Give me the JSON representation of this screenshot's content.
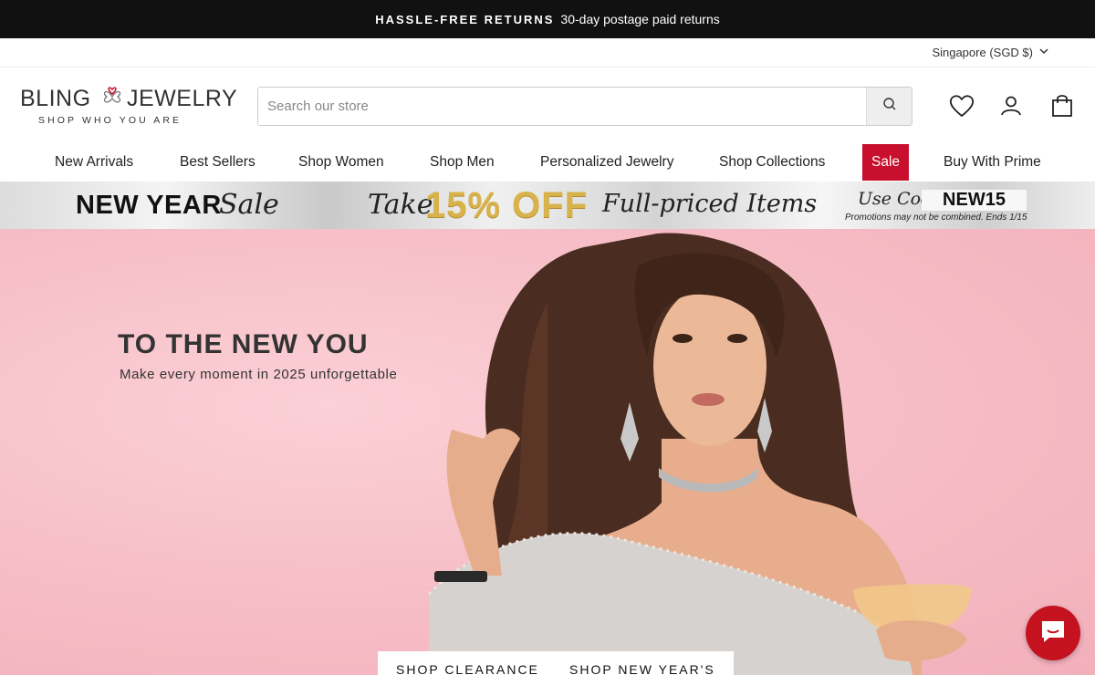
{
  "announcement": {
    "strong": "HASSLE-FREE RETURNS",
    "text": "30-day postage paid returns"
  },
  "locale": {
    "label": "Singapore (SGD $)"
  },
  "logo": {
    "word_left": "BLING",
    "word_right": "JEWELRY",
    "tagline": "SHOP WHO YOU ARE"
  },
  "search": {
    "placeholder": "Search our store"
  },
  "nav": {
    "items": [
      {
        "label": "New Arrivals"
      },
      {
        "label": "Best Sellers"
      },
      {
        "label": "Shop Women"
      },
      {
        "label": "Shop Men"
      },
      {
        "label": "Personalized Jewelry"
      },
      {
        "label": "Shop Collections"
      },
      {
        "label": "Sale"
      },
      {
        "label": "Buy With Prime"
      }
    ]
  },
  "promo": {
    "new_year": "NEW YEAR",
    "sale": "Sale",
    "take": "Take",
    "off": "15% OFF",
    "full_priced": "Full-priced Items",
    "use_code": "Use Code",
    "code": "NEW15",
    "fine_print": "Promotions may not be combined. Ends 1/15"
  },
  "hero": {
    "title": "TO THE NEW YOU",
    "subtitle": "Make every moment in 2025 unforgettable",
    "btn_clearance": "SHOP CLEARANCE",
    "btn_new_years": "SHOP NEW YEAR'S"
  },
  "colors": {
    "announce_bg": "#111111",
    "sale_red": "#c8102e",
    "hero_pink": "#f6bcc5",
    "gold": "#d8b24a",
    "chat_red": "#c4131f"
  },
  "icons": [
    "chevron-down-icon",
    "search-icon",
    "heart-icon",
    "user-icon",
    "cart-icon",
    "chat-icon"
  ]
}
